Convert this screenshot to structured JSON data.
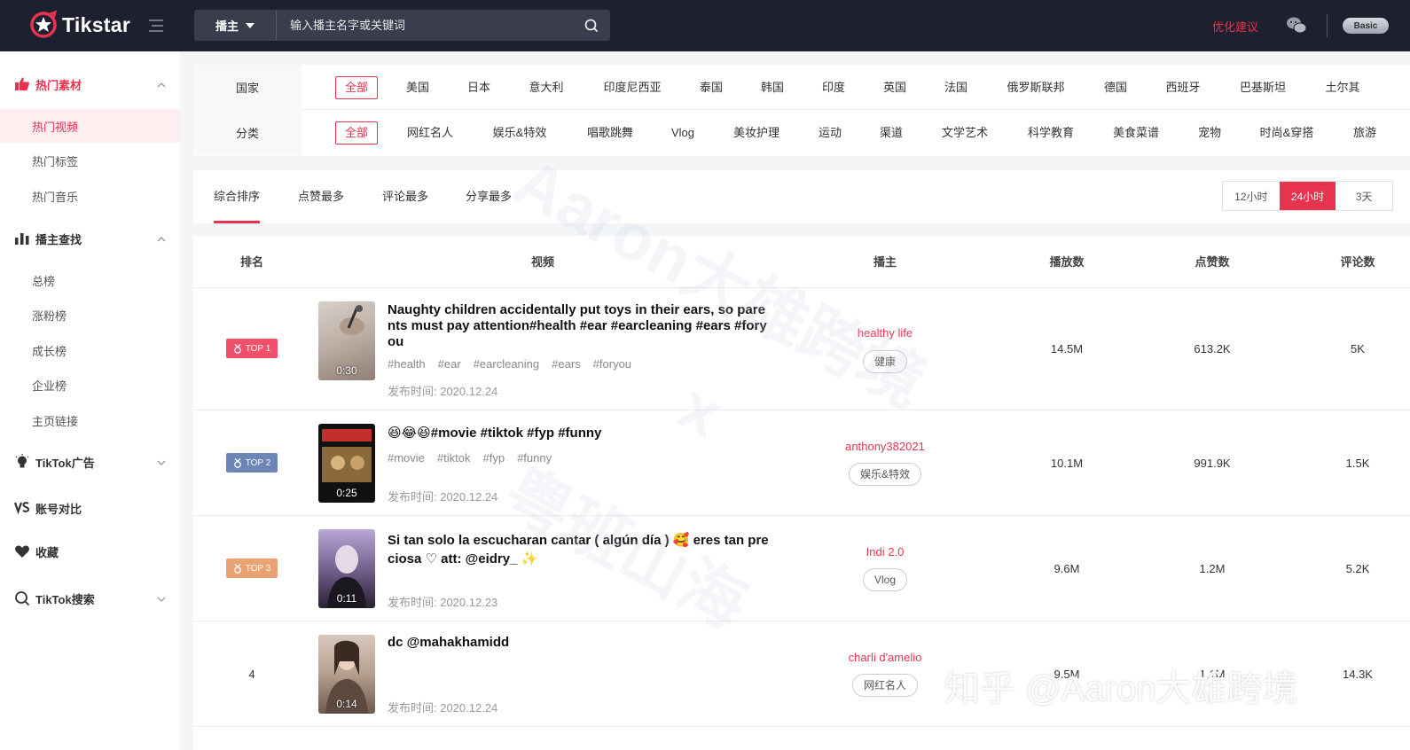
{
  "app": {
    "brand": "Tikstar"
  },
  "colors": {
    "accent": "#e8334f",
    "topbar": "#1e2030",
    "top2": "#6c85b6",
    "top3": "#e9a272"
  },
  "search": {
    "type_label": "播主",
    "placeholder": "输入播主名字或关键词"
  },
  "header": {
    "suggest": "优化建议",
    "vip": "Basic"
  },
  "sidebar": {
    "sections": [
      {
        "label": "热门素材",
        "icon": "thumbs-up-icon"
      },
      {
        "label": "播主查找",
        "icon": "bar-chart-icon"
      },
      {
        "label": "TikTok广告",
        "icon": "bulb-icon"
      },
      {
        "label": "账号对比",
        "icon": "vs-icon"
      },
      {
        "label": "收藏",
        "icon": "heart-icon"
      },
      {
        "label": "TikTok搜索",
        "icon": "search-icon"
      }
    ],
    "items": [
      "热门视频",
      "热门标签",
      "热门音乐",
      "总榜",
      "涨粉榜",
      "成长榜",
      "企业榜",
      "主页链接"
    ]
  },
  "filters": {
    "country": {
      "label": "国家",
      "options": [
        "全部",
        "美国",
        "日本",
        "意大利",
        "印度尼西亚",
        "泰国",
        "韩国",
        "印度",
        "英国",
        "法国",
        "俄罗斯联邦",
        "德国",
        "西班牙",
        "巴基斯坦",
        "土尔其"
      ]
    },
    "category": {
      "label": "分类",
      "options": [
        "全部",
        "网红名人",
        "娱乐&特效",
        "唱歌跳舞",
        "Vlog",
        "美妆护理",
        "运动",
        "渠道",
        "文学艺术",
        "科学教育",
        "美食菜谱",
        "宠物",
        "时尚&穿搭",
        "旅游"
      ]
    }
  },
  "sort": {
    "tabs": [
      "综合排序",
      "点赞最多",
      "评论最多",
      "分享最多"
    ],
    "time": [
      "12小时",
      "24小时",
      "3天"
    ]
  },
  "table": {
    "headers": [
      "排名",
      "视频",
      "播主",
      "播放数",
      "点赞数",
      "评论数"
    ],
    "rows": [
      {
        "rank": "TOP 1",
        "duration": "0:30",
        "title": "Naughty children accidentally put toys in their ears, so parents must pay attention#health #ear #earcleaning #ears #foryou",
        "tags": [
          "#health",
          "#ear",
          "#earcleaning",
          "#ears",
          "#foryou"
        ],
        "date": "发布时间: 2020.12.24",
        "author": "healthy life",
        "category": "健康",
        "plays": "14.5M",
        "likes": "613.2K",
        "comments": "5K"
      },
      {
        "rank": "TOP 2",
        "duration": "0:25",
        "title": "😆😂😆#movie #tiktok #fyp #funny",
        "tags": [
          "#movie",
          "#tiktok",
          "#fyp",
          "#funny"
        ],
        "date": "发布时间: 2020.12.24",
        "author": "anthony382021",
        "category": "娱乐&特效",
        "plays": "10.1M",
        "likes": "991.9K",
        "comments": "1.5K"
      },
      {
        "rank": "TOP 3",
        "duration": "0:11",
        "title": "Si tan solo la escucharan cantar ( algún día ) 🥰 eres tan preciosa ♡ att: @eidry_ ✨",
        "tags": [],
        "date": "发布时间: 2020.12.23",
        "author": "Indi 2.0",
        "category": "Vlog",
        "plays": "9.6M",
        "likes": "1.2M",
        "comments": "5.2K"
      },
      {
        "rank": "4",
        "duration": "0:14",
        "title": "dc @mahakhamidd",
        "tags": [],
        "date": "发布时间: 2020.12.24",
        "author": "charli d'amelio",
        "category": "网红名人",
        "plays": "9.5M",
        "likes": "1.1M",
        "comments": "14.3K"
      }
    ]
  },
  "watermark": {
    "line1": "Aaron大雄跨境",
    "line2": "x",
    "line3": "粤班山海",
    "corner": "知乎 @Aaron大雄跨境"
  }
}
